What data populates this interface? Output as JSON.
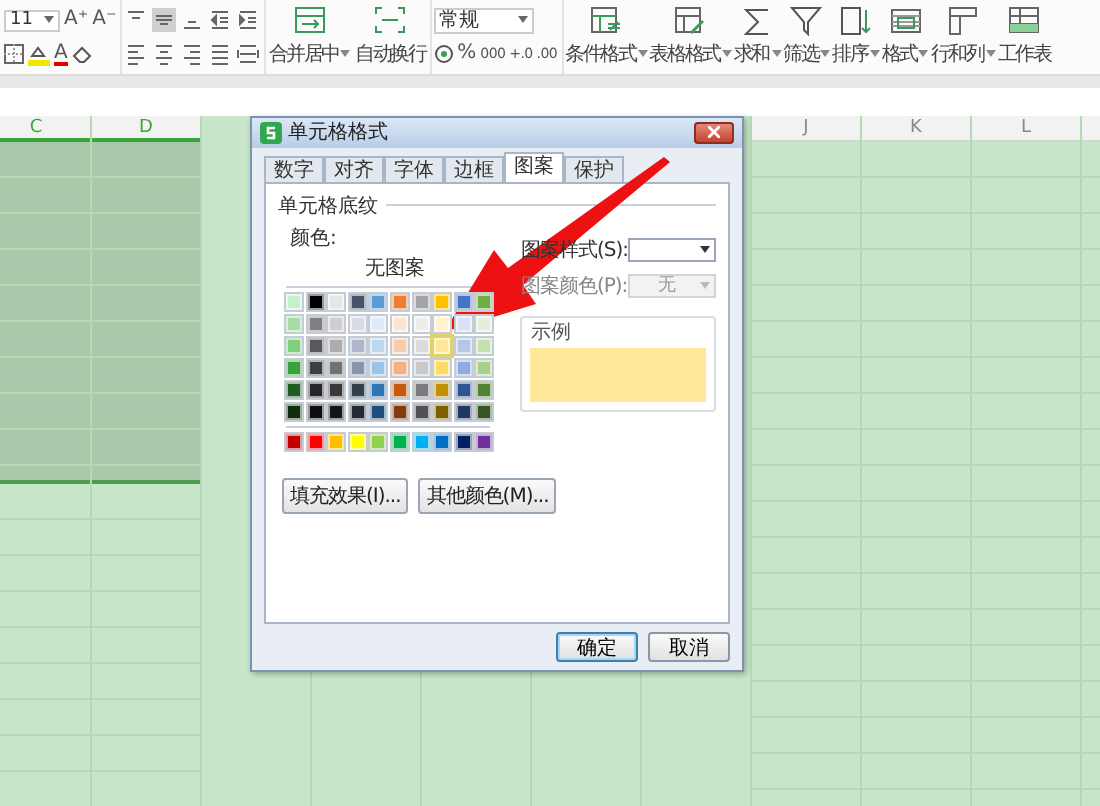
{
  "ribbon": {
    "font_size": "11",
    "font_buttons": [
      "A⁺",
      "A⁻"
    ],
    "font_color": "A",
    "align_buttons": [
      {
        "kind": "top",
        "selected": false
      },
      {
        "kind": "middle",
        "selected": true
      },
      {
        "kind": "bottom",
        "selected": false
      },
      {
        "kind": "outdent",
        "selected": false
      },
      {
        "kind": "indent",
        "selected": false
      },
      {
        "kind": "left",
        "selected": false
      },
      {
        "kind": "center",
        "selected": false
      },
      {
        "kind": "right",
        "selected": false
      },
      {
        "kind": "justify",
        "selected": false
      },
      {
        "kind": "distribute",
        "selected": false
      }
    ],
    "merge_buttons": [
      {
        "kind": "merge",
        "label": "合并居中",
        "dropdown": true
      },
      {
        "kind": "wrap",
        "label": "自动换行",
        "dropdown": false
      }
    ],
    "number_format": "常规",
    "number_buttons": [
      "%",
      "000",
      "+.0",
      ".00"
    ],
    "tool_buttons": [
      {
        "kind": "conditional",
        "label": "条件格式",
        "dropdown": true
      },
      {
        "kind": "table_style",
        "label": "表格格式",
        "dropdown": true
      },
      {
        "kind": "sum",
        "label": "求和",
        "dropdown": true
      },
      {
        "kind": "filter",
        "label": "筛选",
        "dropdown": true
      },
      {
        "kind": "sort",
        "label": "排序",
        "dropdown": true
      },
      {
        "kind": "format",
        "label": "格式",
        "dropdown": true
      },
      {
        "kind": "rows_cols",
        "label": "行和列",
        "dropdown": true
      },
      {
        "kind": "sheet",
        "label": "工作表",
        "dropdown": false
      }
    ]
  },
  "sheet": {
    "left_columns": [
      {
        "label": "C",
        "selected": true
      },
      {
        "label": "D",
        "selected": true
      }
    ],
    "right_columns": [
      {
        "label": "J",
        "selected": false
      },
      {
        "label": "K",
        "selected": false
      },
      {
        "label": "L",
        "selected": false
      }
    ]
  },
  "dialog": {
    "title": "单元格格式",
    "tabs": [
      {
        "label": "数字",
        "selected": false
      },
      {
        "label": "对齐",
        "selected": false
      },
      {
        "label": "字体",
        "selected": false
      },
      {
        "label": "边框",
        "selected": false
      },
      {
        "label": "图案",
        "selected": true
      },
      {
        "label": "保护",
        "selected": false
      }
    ],
    "section": "单元格底纹",
    "color_label": "颜色:",
    "no_pattern": "无图案",
    "palette": [
      {
        "kind": "theme",
        "swatches": [
          {
            "color": "#c6efce",
            "selected": false
          },
          {
            "color": "#000000",
            "selected": false
          },
          {
            "color": "#e7e6e6",
            "selected": false
          },
          {
            "color": "#44546a",
            "selected": false
          },
          {
            "color": "#5b9bd5",
            "selected": false
          },
          {
            "color": "#ed7d31",
            "selected": false
          },
          {
            "color": "#a5a5a5",
            "selected": false
          },
          {
            "color": "#ffc000",
            "selected": false
          },
          {
            "color": "#4472c4",
            "selected": false
          },
          {
            "color": "#70ad47",
            "selected": false
          }
        ]
      },
      {
        "kind": "shades",
        "swatches": [
          {
            "color": "#a9dba9",
            "selected": false
          },
          {
            "color": "#7f7f7f",
            "selected": false
          },
          {
            "color": "#d0cece",
            "selected": false
          },
          {
            "color": "#d6dce4",
            "selected": false
          },
          {
            "color": "#deebf6",
            "selected": false
          },
          {
            "color": "#fbe5d5",
            "selected": false
          },
          {
            "color": "#ededed",
            "selected": false
          },
          {
            "color": "#fff2cc",
            "selected": false
          },
          {
            "color": "#dae3f3",
            "selected": false
          },
          {
            "color": "#e2efd9",
            "selected": false
          }
        ]
      },
      {
        "kind": "shades",
        "swatches": [
          {
            "color": "#7fcf7f",
            "selected": false
          },
          {
            "color": "#595959",
            "selected": false
          },
          {
            "color": "#aeabab",
            "selected": false
          },
          {
            "color": "#adb9ca",
            "selected": false
          },
          {
            "color": "#bdd7ee",
            "selected": false
          },
          {
            "color": "#f7cbac",
            "selected": false
          },
          {
            "color": "#dbdbdb",
            "selected": false
          },
          {
            "color": "#ffe699",
            "selected": true
          },
          {
            "color": "#b4c7e7",
            "selected": false
          },
          {
            "color": "#c5e0b3",
            "selected": false
          }
        ]
      },
      {
        "kind": "shades",
        "swatches": [
          {
            "color": "#38a03a",
            "selected": false
          },
          {
            "color": "#3f3f3f",
            "selected": false
          },
          {
            "color": "#757070",
            "selected": false
          },
          {
            "color": "#8496b0",
            "selected": false
          },
          {
            "color": "#9dc3e6",
            "selected": false
          },
          {
            "color": "#f4b183",
            "selected": false
          },
          {
            "color": "#c9c9c9",
            "selected": false
          },
          {
            "color": "#ffd966",
            "selected": false
          },
          {
            "color": "#8faadc",
            "selected": false
          },
          {
            "color": "#a8d08d",
            "selected": false
          }
        ]
      },
      {
        "kind": "shades",
        "swatches": [
          {
            "color": "#1f5c20",
            "selected": false
          },
          {
            "color": "#262626",
            "selected": false
          },
          {
            "color": "#3a3838",
            "selected": false
          },
          {
            "color": "#323f4f",
            "selected": false
          },
          {
            "color": "#2e75b5",
            "selected": false
          },
          {
            "color": "#c55a11",
            "selected": false
          },
          {
            "color": "#7b7b7b",
            "selected": false
          },
          {
            "color": "#bf9000",
            "selected": false
          },
          {
            "color": "#2f5496",
            "selected": false
          },
          {
            "color": "#538135",
            "selected": false
          }
        ]
      },
      {
        "kind": "shades",
        "swatches": [
          {
            "color": "#0f2e10",
            "selected": false
          },
          {
            "color": "#0d0d0d",
            "selected": false
          },
          {
            "color": "#171616",
            "selected": false
          },
          {
            "color": "#222a35",
            "selected": false
          },
          {
            "color": "#1e4e79",
            "selected": false
          },
          {
            "color": "#833c0b",
            "selected": false
          },
          {
            "color": "#525252",
            "selected": false
          },
          {
            "color": "#7f6000",
            "selected": false
          },
          {
            "color": "#1f3864",
            "selected": false
          },
          {
            "color": "#375623",
            "selected": false
          }
        ]
      },
      {
        "kind": "standard",
        "swatches": [
          {
            "color": "#c00000",
            "selected": false
          },
          {
            "color": "#ff0000",
            "selected": false
          },
          {
            "color": "#ffc000",
            "selected": false
          },
          {
            "color": "#ffff00",
            "selected": false
          },
          {
            "color": "#92d050",
            "selected": false
          },
          {
            "color": "#00b050",
            "selected": false
          },
          {
            "color": "#00b0f0",
            "selected": false
          },
          {
            "color": "#0070c0",
            "selected": false
          },
          {
            "color": "#002060",
            "selected": false
          },
          {
            "color": "#7030a0",
            "selected": false
          }
        ]
      }
    ],
    "pattern_style": {
      "label": "图案样式(S):",
      "disabled": false
    },
    "pattern_color": {
      "label": "图案颜色(P):",
      "value": "无",
      "disabled": true
    },
    "sample_label": "示例",
    "buttons": [
      "填充效果(I)...",
      "其他颜色(M)..."
    ],
    "footer_buttons": [
      {
        "label": "确定",
        "default": true
      },
      {
        "label": "取消",
        "default": false
      }
    ]
  },
  "annotation": {
    "kind": "arrow"
  }
}
